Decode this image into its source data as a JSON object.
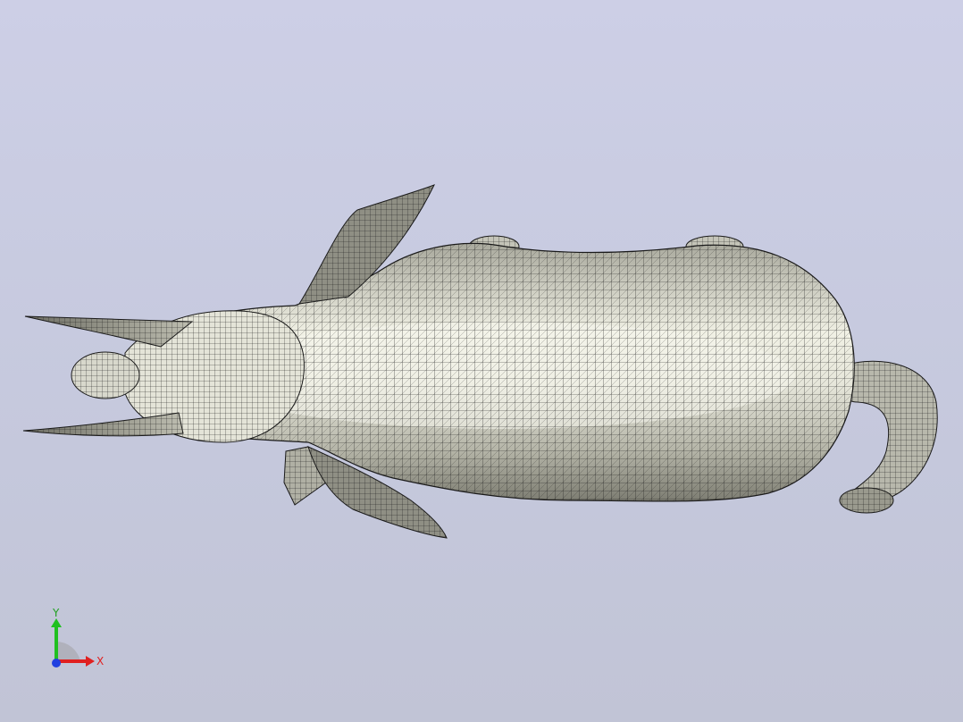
{
  "viewport": {
    "background_top": "#cdcfe6",
    "background_bottom": "#c1c4d6",
    "model_fill": "#dcdccf",
    "mesh_line_color": "#1a1a1a"
  },
  "triad": {
    "x_label": "X",
    "y_label": "Y",
    "x_color": "#e02020",
    "y_color": "#20c020",
    "z_color": "#2040e0"
  }
}
